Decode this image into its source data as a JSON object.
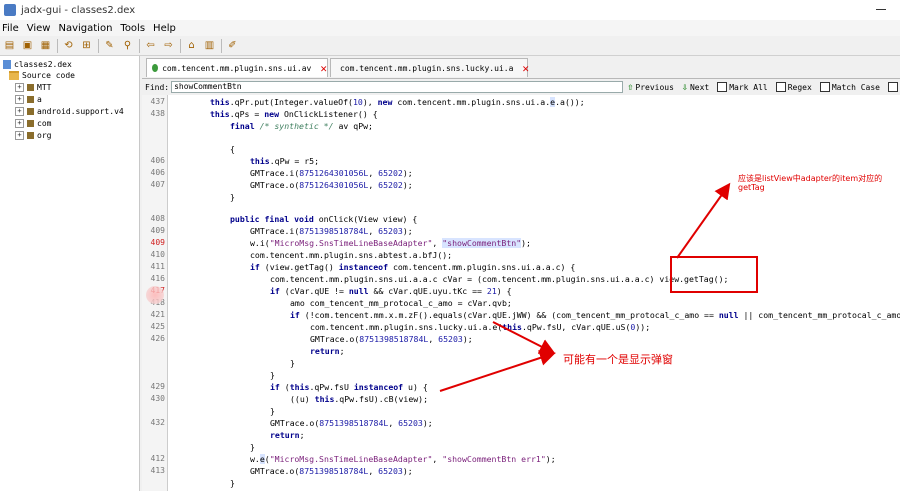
{
  "window": {
    "title": "jadx-gui - classes2.dex"
  },
  "menu": [
    "File",
    "View",
    "Navigation",
    "Tools",
    "Help"
  ],
  "toolbar_icons": [
    "open-icon",
    "save-icon",
    "save-all-icon",
    "sync-icon",
    "flatten-icon",
    "wrench-icon",
    "search-icon",
    "back-icon",
    "forward-icon",
    "preferences-icon",
    "log-icon",
    "settings-icon"
  ],
  "tree": {
    "root": "classes2.dex",
    "source": "Source code",
    "packages": [
      "MTT",
      "a",
      "android.support.v4",
      "com",
      "org"
    ]
  },
  "tabs": [
    {
      "label": "com.tencent.mm.plugin.sns.ui.av"
    },
    {
      "label": "com.tencent.mm.plugin.sns.lucky.ui.a"
    }
  ],
  "find": {
    "label": "Find:",
    "value": "showCommentBtn",
    "previous": "Previous",
    "next": "Next",
    "mark_all": "Mark All",
    "regex": "Regex",
    "match_case": "Match Case"
  },
  "code": {
    "line_numbers": [
      "437",
      "438",
      "",
      "",
      "",
      "406",
      "406",
      "407",
      "",
      "",
      "408",
      "409",
      "409",
      "410",
      "411",
      "416",
      "417",
      "418",
      "421",
      "425",
      "426",
      "",
      "",
      "",
      "429",
      "430",
      "",
      "432",
      "",
      "",
      "412",
      "413",
      "",
      ""
    ],
    "red_line_numbers": [
      12,
      16
    ]
  },
  "annotations": {
    "top": "应该是listView中adapter的item对应的",
    "top_sub": "getTag",
    "middle": "可能有一个是显示弹窗"
  },
  "colors": {
    "annotation": "#e00000",
    "keyword": "#00008b",
    "string": "#7a1f7a"
  }
}
